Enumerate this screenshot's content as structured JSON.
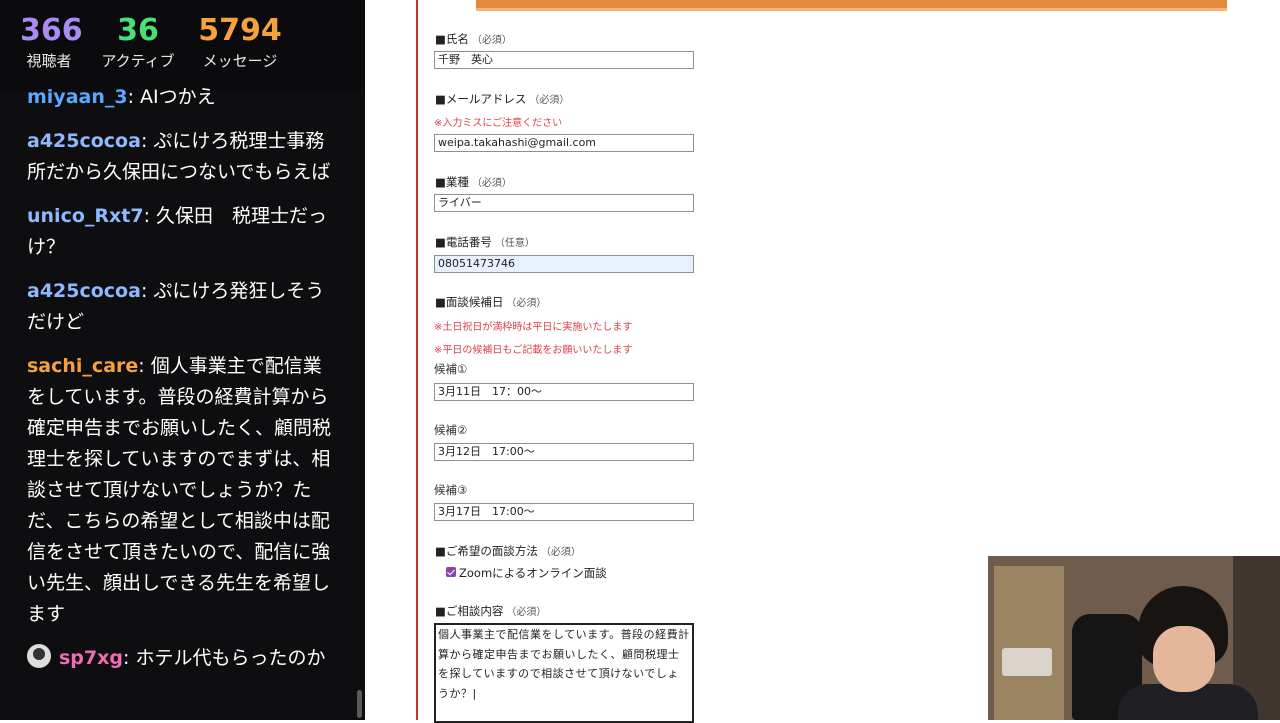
{
  "stats": {
    "viewers": {
      "value": "366",
      "label": "視聴者"
    },
    "active": {
      "value": "36",
      "label": "アクティブ"
    },
    "messages": {
      "value": "5794",
      "label": "メッセージ"
    }
  },
  "chat": [
    {
      "user": "miyaan_3",
      "color": "#5aa7ff",
      "text": " AIつかえ"
    },
    {
      "user": "a425cocoa",
      "color": "#8fb8ff",
      "text": " ぷにけろ税理士事務所だから久保田につないでもらえば"
    },
    {
      "user": "unico_Rxt7",
      "color": "#8fb8ff",
      "text": " 久保田　税理士だっけ？"
    },
    {
      "user": "a425cocoa",
      "color": "#8fb8ff",
      "text": " ぷにけろ発狂しそうだけど"
    },
    {
      "user": "sachi_care",
      "color": "#f4a13e",
      "text": " 個人事業主で配信業をしています。普段の経費計算から確定申告までお願いしたく、顧問税理士を探していますのでまずは、相談させて頂けないでしょうか？ただ、こちらの希望として相談中は配信をさせて頂きたいので、配信に強い先生、顔出しできる先生を希望します"
    },
    {
      "user": "sp7xg",
      "color": "#f16bb5",
      "text": " ホテル代もらったのか"
    }
  ],
  "form": {
    "name": {
      "label": "■氏名",
      "req": "（必須）",
      "value": "千野　英心"
    },
    "email": {
      "label": "■メールアドレス",
      "req": "（必須）",
      "note": "※入力ミスにご注意ください",
      "value": "weipa.takahashi@gmail.com"
    },
    "industry": {
      "label": "■業種",
      "req": "（必須）",
      "value": "ライバー"
    },
    "phone": {
      "label": "■電話番号",
      "req": "（任意）",
      "value": "08051473746"
    },
    "dates": {
      "label": "■面談候補日",
      "req": "（必須）",
      "note1": "※土日祝日が満枠時は平日に実施いたします",
      "note2": "※平日の候補日もご記載をお願いいたします",
      "c1_label": "候補①",
      "c1_value": "3月11日　17：00〜",
      "c2_label": "候補②",
      "c2_value": "3月12日　17:00〜",
      "c3_label": "候補③",
      "c3_value": "3月17日　17:00〜"
    },
    "method": {
      "label": "■ご希望の面談方法",
      "req": "（必須）",
      "option": "Zoomによるオンライン面談"
    },
    "consult": {
      "label": "■ご相談内容",
      "req": "（必須）",
      "value": "個人事業主で配信業をしています。普段の経費計算から確定申告までお願いしたく、顧問税理士を探していますので相談させて頂けないでしょうか？|"
    }
  }
}
